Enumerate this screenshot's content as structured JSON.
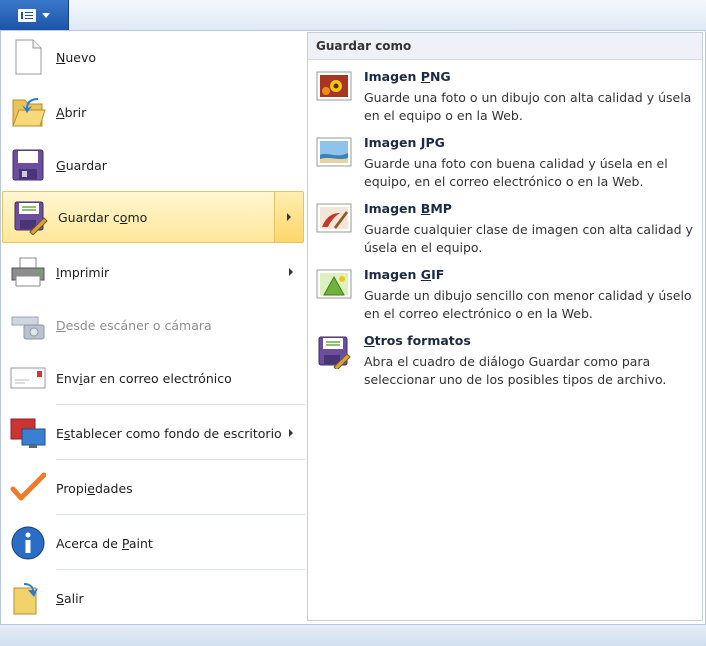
{
  "app": {
    "menu_button": "paint-menu"
  },
  "menu": {
    "items": [
      {
        "pre": "",
        "u": "N",
        "post": "uevo",
        "icon": "new-document-icon"
      },
      {
        "pre": "",
        "u": "A",
        "post": "brir",
        "icon": "open-folder-icon"
      },
      {
        "pre": "",
        "u": "G",
        "post": "uardar",
        "icon": "save-disk-icon"
      },
      {
        "pre": "Guardar c",
        "u": "o",
        "post": "mo",
        "icon": "save-as-icon"
      },
      {
        "pre": "",
        "u": "I",
        "post": "mprimir",
        "icon": "printer-icon"
      },
      {
        "pre": "",
        "u": "D",
        "post": "esde escáner o cámara",
        "icon": "scanner-camera-icon"
      },
      {
        "pre": "Env",
        "u": "i",
        "post": "ar en correo electrónico",
        "icon": "email-icon"
      },
      {
        "pre": "E",
        "u": "s",
        "post": "tablecer como fondo de escritorio",
        "icon": "desktop-background-icon"
      },
      {
        "pre": "Propi",
        "u": "e",
        "post": "dades",
        "icon": "checkmark-icon"
      },
      {
        "pre": "Acerca de ",
        "u": "P",
        "post": "aint",
        "icon": "info-icon"
      },
      {
        "pre": "",
        "u": "S",
        "post": "alir",
        "icon": "exit-icon"
      }
    ]
  },
  "save_as": {
    "title": "Guardar como",
    "options": [
      {
        "pre": "Imagen ",
        "u": "P",
        "post": "NG",
        "desc": "Guarde una foto o un dibujo con alta calidad y úsela en el equipo o en la Web.",
        "icon": "png-image-icon"
      },
      {
        "pre": "Imagen ",
        "u": "J",
        "post": "PG",
        "desc": "Guarde una foto con buena calidad y úsela en el equipo, en el correo electrónico o en la Web.",
        "icon": "jpg-image-icon"
      },
      {
        "pre": "Imagen ",
        "u": "B",
        "post": "MP",
        "desc": "Guarde cualquier clase de imagen con alta calidad y úsela en el equipo.",
        "icon": "bmp-image-icon"
      },
      {
        "pre": "Imagen ",
        "u": "G",
        "post": "IF",
        "desc": "Guarde un dibujo sencillo con menor calidad y úselo en el correo electrónico o en la Web.",
        "icon": "gif-image-icon"
      },
      {
        "pre": "",
        "u": "O",
        "post": "tros formatos",
        "desc": "Abra el cuadro de diálogo Guardar como para seleccionar uno de los posibles tipos de archivo.",
        "icon": "other-formats-icon"
      }
    ]
  }
}
